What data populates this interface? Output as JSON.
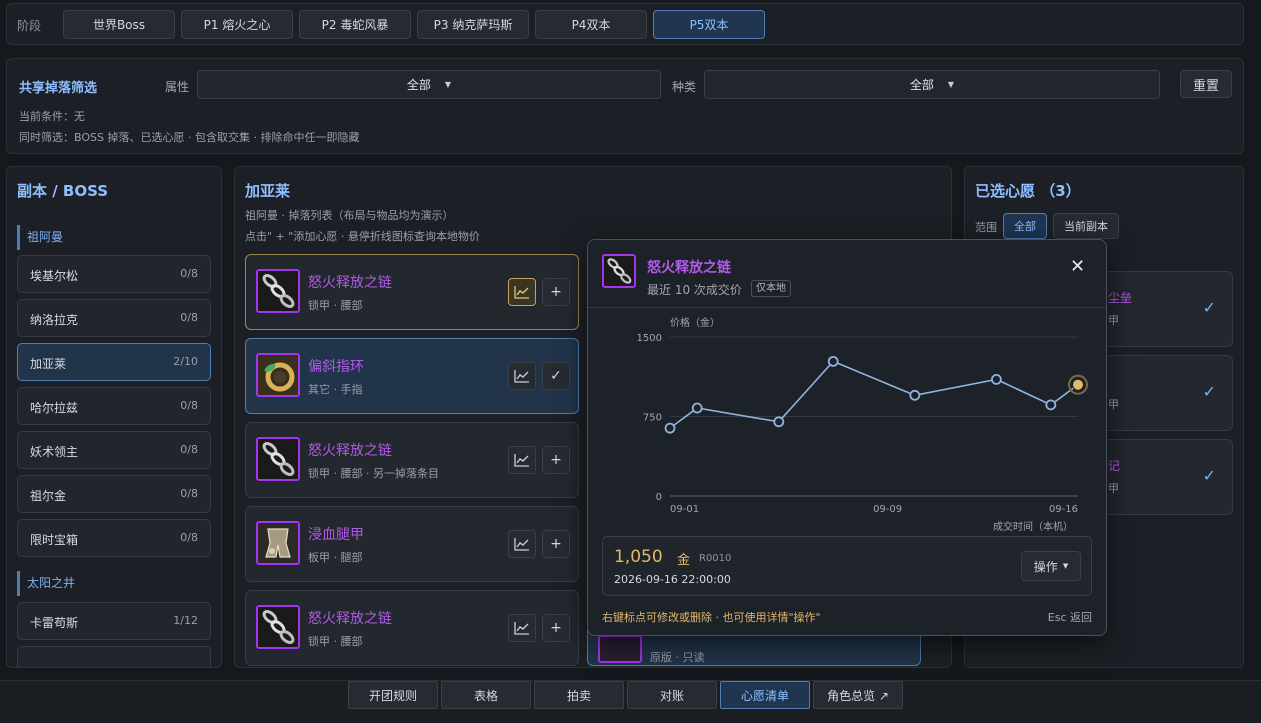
{
  "stage": {
    "label": "阶段",
    "buttons": [
      "世界Boss",
      "P1 熔火之心",
      "P2 毒蛇风暴",
      "P3 纳克萨玛斯",
      "P4双本",
      "P5双本"
    ],
    "active_index": 5
  },
  "filter": {
    "title": "共享掉落筛选",
    "attr_label": "属性",
    "attr_value": "全部",
    "type_label": "种类",
    "type_value": "全部",
    "reset": "重置",
    "condition": "当前条件：无",
    "simultaneous": "同时筛选：BOSS 掉落、已选心愿 · 包含取交集 · 排除命中任一即隐藏"
  },
  "boss_panel": {
    "title": "副本 / BOSS",
    "groups": [
      {
        "label": "祖阿曼"
      },
      {
        "label": "太阳之井"
      }
    ],
    "bosses": [
      {
        "name": "埃基尔松",
        "count": "0/8"
      },
      {
        "name": "纳洛拉克",
        "count": "0/8"
      },
      {
        "name": "加亚莱",
        "count": "2/10"
      },
      {
        "name": "哈尔拉兹",
        "count": "0/8"
      },
      {
        "name": "妖术领主",
        "count": "0/8"
      },
      {
        "name": "祖尔金",
        "count": "0/8"
      },
      {
        "name": "限时宝箱",
        "count": "0/8"
      },
      {
        "name": "卡雷苟斯",
        "count": "1/12"
      }
    ]
  },
  "drops": {
    "title": "加亚莱",
    "sub1": "祖阿曼 · 掉落列表（布局与物品均为演示）",
    "sub2": "点击\" + \"添加心愿 · 悬停折线图标查询本地物价",
    "items": [
      {
        "name": "怒火释放之链",
        "meta": "锁甲 · 腰部",
        "icon": "chain-icon",
        "action": "+"
      },
      {
        "name": "偏斜指环",
        "meta": "其它 · 手指",
        "icon": "ring-icon",
        "action": "✓"
      },
      {
        "name": "怒火释放之链",
        "meta": "锁甲 · 腰部 · 另一掉落条目",
        "icon": "chain-icon",
        "action": "+"
      },
      {
        "name": "浸血腿甲",
        "meta": "板甲 · 腿部",
        "icon": "legs-icon",
        "action": "+"
      },
      {
        "name": "怒火释放之链",
        "meta": "锁甲 · 腰部",
        "icon": "chain-icon",
        "action": "+"
      }
    ],
    "hidden_peek_meta": "原版 · 只读"
  },
  "wish": {
    "title": "已选心愿 （3）",
    "scope_label": "范围",
    "scope_all": "全部",
    "scope_current": "当前副本",
    "cards": [
      {
        "name": "尘垒",
        "meta": "甲",
        "name_color": "#b15ae8"
      },
      {
        "name": "",
        "meta": "甲",
        "name_color": "#b15ae8"
      },
      {
        "name": "记",
        "meta": "甲",
        "name_color": "#b15ae8"
      }
    ]
  },
  "popup": {
    "title": "怒火释放之链",
    "subtitle": "最近 10 次成交价",
    "local_tag": "仅本地",
    "close": "✕",
    "price": "1,050",
    "unit": "金",
    "record_id": "R0010",
    "time": "2026-09-16 22:00:00",
    "op_button": "操作",
    "hint": "右键标点可修改或删除 · 也可使用详情\"操作\"",
    "esc": "Esc 返回"
  },
  "chart_data": {
    "type": "line",
    "ylabel": "价格（金）",
    "xlabel": "成交时间（本机）",
    "ylim": [
      0,
      1500
    ],
    "yticks": [
      0,
      750,
      1500
    ],
    "xticks": [
      "09-01",
      "09-09",
      "09-16"
    ],
    "x": [
      "09-01",
      "09-02",
      "09-05",
      "09-07",
      "09-10",
      "09-13",
      "09-15",
      "09-16"
    ],
    "values": [
      640,
      830,
      700,
      1270,
      950,
      1100,
      860,
      1050
    ],
    "highlight_index": 7,
    "line_color": "#8fb4de",
    "highlight_color": "#e2b869"
  },
  "bottom_tabs": {
    "items": [
      "开团规则",
      "表格",
      "拍卖",
      "对账",
      "心愿清单",
      "角色总览 ↗"
    ],
    "active_index": 4
  }
}
